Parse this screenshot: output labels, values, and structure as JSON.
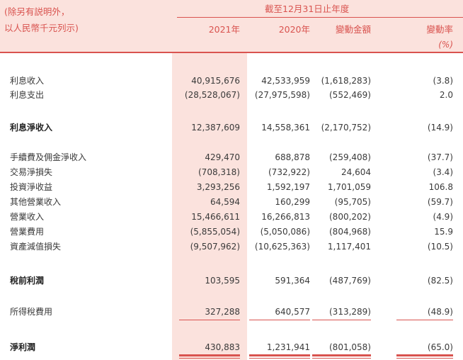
{
  "header": {
    "note_line1": "(除另有説明外，",
    "note_line2": "以人民幣千元列示)",
    "period": "截至12月31日止年度",
    "col_2021": "2021年",
    "col_2020": "2020年",
    "col_change": "變動金額",
    "col_rate": "變動率",
    "rate_unit": "(%)"
  },
  "rows": [
    {
      "label": "利息收入",
      "y2021": "40,915,676",
      "y2020": "42,533,959",
      "change": "(1,618,283)",
      "rate": "(3.8)"
    },
    {
      "label": "利息支出",
      "y2021": "(28,528,067)",
      "y2020": "(27,975,598)",
      "change": "(552,469)",
      "rate": "2.0"
    },
    {
      "label": "利息淨收入",
      "y2021": "12,387,609",
      "y2020": "14,558,361",
      "change": "(2,170,752)",
      "rate": "(14.9)"
    },
    {
      "label": "手續費及佣金淨收入",
      "y2021": "429,470",
      "y2020": "688,878",
      "change": "(259,408)",
      "rate": "(37.7)"
    },
    {
      "label": "交易淨損失",
      "y2021": "(708,318)",
      "y2020": "(732,922)",
      "change": "24,604",
      "rate": "(3.4)"
    },
    {
      "label": "投資淨收益",
      "y2021": "3,293,256",
      "y2020": "1,592,197",
      "change": "1,701,059",
      "rate": "106.8"
    },
    {
      "label": "其他營業收入",
      "y2021": "64,594",
      "y2020": "160,299",
      "change": "(95,705)",
      "rate": "(59.7)"
    },
    {
      "label": "營業收入",
      "y2021": "15,466,611",
      "y2020": "16,266,813",
      "change": "(800,202)",
      "rate": "(4.9)"
    },
    {
      "label": "營業費用",
      "y2021": "(5,855,054)",
      "y2020": "(5,050,086)",
      "change": "(804,968)",
      "rate": "15.9"
    },
    {
      "label": "資產減值損失",
      "y2021": "(9,507,962)",
      "y2020": "(10,625,363)",
      "change": "1,117,401",
      "rate": "(10.5)"
    },
    {
      "label": "稅前利潤",
      "y2021": "103,595",
      "y2020": "591,364",
      "change": "(487,769)",
      "rate": "(82.5)"
    },
    {
      "label": "所得稅費用",
      "y2021": "327,288",
      "y2020": "640,577",
      "change": "(313,289)",
      "rate": "(48.9)"
    },
    {
      "label": "淨利潤",
      "y2021": "430,883",
      "y2020": "1,231,941",
      "change": "(801,058)",
      "rate": "(65.0)"
    }
  ],
  "colors": {
    "accent": "#d9534f",
    "shade": "#fbe2dd"
  }
}
